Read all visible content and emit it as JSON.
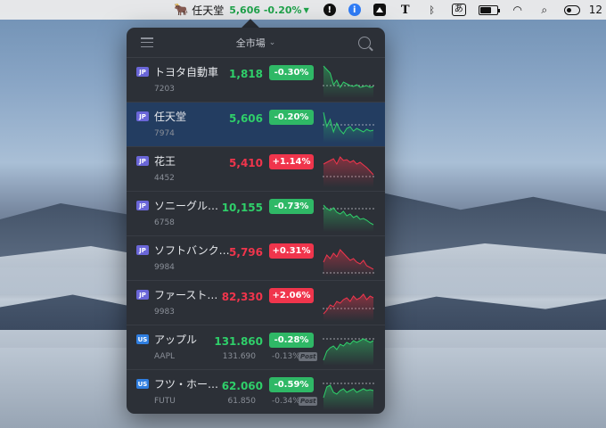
{
  "menubar": {
    "ticker": {
      "name": "任天堂",
      "quote": "5,606 -0.20%"
    },
    "ja_input": "あ",
    "clock": "12",
    "accent_up": "#f0354c",
    "accent_down": "#2fcf6a"
  },
  "popover": {
    "market": "全市場",
    "stocks": [
      {
        "market": "JP",
        "name": "トヨタ自動車",
        "code": "7203",
        "price": "1,818",
        "change": "-0.30%",
        "dir": "down"
      },
      {
        "market": "JP",
        "name": "任天堂",
        "code": "7974",
        "price": "5,606",
        "change": "-0.20%",
        "dir": "down",
        "selected": true
      },
      {
        "market": "JP",
        "name": "花王",
        "code": "4452",
        "price": "5,410",
        "change": "+1.14%",
        "dir": "up"
      },
      {
        "market": "JP",
        "name": "ソニーグル…",
        "code": "6758",
        "price": "10,155",
        "change": "-0.73%",
        "dir": "down"
      },
      {
        "market": "JP",
        "name": "ソフトバンク…",
        "code": "9984",
        "price": "5,796",
        "change": "+0.31%",
        "dir": "up"
      },
      {
        "market": "JP",
        "name": "ファースト…",
        "code": "9983",
        "price": "82,330",
        "change": "+2.06%",
        "dir": "up"
      },
      {
        "market": "US",
        "name": "アップル",
        "code": "AAPL",
        "price": "131.860",
        "change": "-0.28%",
        "dir": "down",
        "post_price": "131.690",
        "post_change": "-0.13%",
        "post_label": "Post"
      },
      {
        "market": "US",
        "name": "フツ・ホー…",
        "code": "FUTU",
        "price": "62.060",
        "change": "-0.59%",
        "dir": "down",
        "post_price": "61.850",
        "post_change": "-0.34%",
        "post_label": "Post"
      }
    ]
  }
}
